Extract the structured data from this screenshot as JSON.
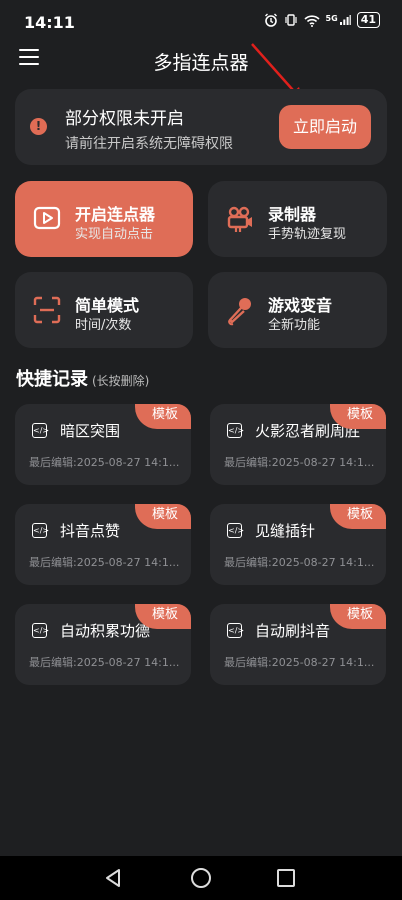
{
  "status": {
    "time": "14:11",
    "icons": [
      "alarm-icon",
      "vibrate-icon",
      "wifi-icon",
      "signal-5g-icon"
    ],
    "network": "5G",
    "battery": "41"
  },
  "header": {
    "title": "多指连点器"
  },
  "permission": {
    "title": "部分权限未开启",
    "subtitle": "请前往开启系统无障碍权限",
    "button": "立即启动",
    "icon": "warning-icon"
  },
  "features": [
    {
      "title": "开启连点器",
      "subtitle": "实现自动点击",
      "icon": "play-window-icon"
    },
    {
      "title": "录制器",
      "subtitle": "手势轨迹复现",
      "icon": "camera-icon"
    },
    {
      "title": "简单模式",
      "subtitle": "时间/次数",
      "icon": "scan-icon"
    },
    {
      "title": "游戏变音",
      "subtitle": "全新功能",
      "icon": "microphone-icon"
    }
  ],
  "records_section": {
    "title": "快捷记录",
    "hint": "(长按删除)"
  },
  "records": [
    {
      "title": "暗区突围",
      "time": "最后编辑:2025-08-27 14:1...",
      "badge": "模板"
    },
    {
      "title": "火影忍者刷周胜",
      "time": "最后编辑:2025-08-27 14:1...",
      "badge": "模板"
    },
    {
      "title": "抖音点赞",
      "time": "最后编辑:2025-08-27 14:1...",
      "badge": "模板"
    },
    {
      "title": "见缝插针",
      "time": "最后编辑:2025-08-27 14:1...",
      "badge": "模板"
    },
    {
      "title": "自动积累功德",
      "time": "最后编辑:2025-08-27 14:1...",
      "badge": "模板"
    },
    {
      "title": "自动刷抖音",
      "time": "最后编辑:2025-08-27 14:1...",
      "badge": "模板"
    }
  ],
  "colors": {
    "accent": "#df6d57",
    "background": "#1e1f21",
    "card": "#2a2b2e",
    "annotation_arrow": "#e0201c"
  }
}
